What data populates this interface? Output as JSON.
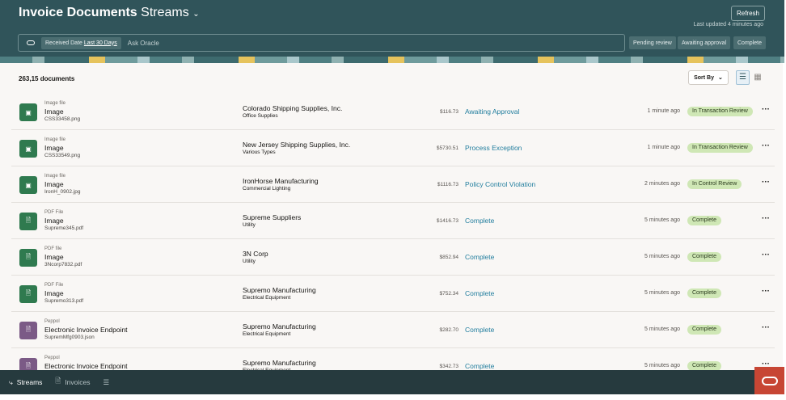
{
  "header": {
    "title_bold": "Invoice Documents",
    "title_stream": "Streams",
    "refresh_label": "Refresh",
    "last_updated": "Last updated 4 minutes ago"
  },
  "search": {
    "chip_label": "Received Date",
    "chip_value": "Last 30 Days",
    "placeholder": "Ask Oracle"
  },
  "quick_filters": [
    "Pending review",
    "Awaiting approval",
    "Complete"
  ],
  "list": {
    "count": "263,15 documents",
    "sort_label": "Sort By"
  },
  "rows": [
    {
      "type": "Image file",
      "kind": "Image",
      "file": "CSS33458.png",
      "vendor": "Colorado Shipping Supplies, Inc.",
      "category": "Office Supplies",
      "amount": "$116.73",
      "status": "Awaiting Approval",
      "time": "1 minute ago",
      "badge": "In Transaction Review",
      "color": "#2f7a4f"
    },
    {
      "type": "Image file",
      "kind": "Image",
      "file": "CSS33549.png",
      "vendor": "New Jersey Shipping Supplies, Inc.",
      "category": "Various Types",
      "amount": "$5730.51",
      "status": "Process Exception",
      "time": "1 minute ago",
      "badge": "In Transaction  Review",
      "color": "#2f7a4f"
    },
    {
      "type": "Image file",
      "kind": "Image",
      "file": "IronH_0902.jpg",
      "vendor": "IronHorse Manufacturing",
      "category": "Commercial Lighting",
      "amount": "$1116.73",
      "status": "Policy Control Violation",
      "time": "2 minutes ago",
      "badge": "In Control Review",
      "color": "#2f7a4f"
    },
    {
      "type": "PDF File",
      "kind": "Image",
      "file": "Supreme345.pdf",
      "vendor": "Supreme Suppliers",
      "category": "Utility",
      "amount": "$1416.73",
      "status": "Complete",
      "time": "5 minutes ago",
      "badge": "Complete",
      "color": "#2f7a4f"
    },
    {
      "type": "PDF file",
      "kind": "Image",
      "file": "3Ncorp7832.pdf",
      "vendor": "3N Corp",
      "category": "Utility",
      "amount": "$852.94",
      "status": "Complete",
      "time": "5 minutes ago",
      "badge": "Complete",
      "color": "#2f7a4f"
    },
    {
      "type": "PDF File",
      "kind": "Image",
      "file": "Supremo313.pdf",
      "vendor": "Supremo Manufacturing",
      "category": "Electrical Equipment",
      "amount": "$752.34",
      "status": "Complete",
      "time": "5 minutes ago",
      "badge": "Complete",
      "color": "#2f7a4f"
    },
    {
      "type": "Peppol",
      "kind": "Electronic Invoice Endpoint",
      "file": "SupremMfg0903.json",
      "vendor": "Supremo Manufacturing",
      "category": "Electrical Equipment",
      "amount": "$282.70",
      "status": "Complete",
      "time": "5 minutes ago",
      "badge": "Complete",
      "color": "#7b5a86"
    },
    {
      "type": "Peppol",
      "kind": "Electronic Invoice Endpoint",
      "file": "",
      "vendor": "Supremo Manufacturing",
      "category": "Electrical Equipment",
      "amount": "$342.73",
      "status": "Complete",
      "time": "5 minutes ago",
      "badge": "Complete",
      "color": "#7b5a86"
    }
  ],
  "bottom_nav": {
    "streams": "Streams",
    "invoices": "Invoices"
  }
}
